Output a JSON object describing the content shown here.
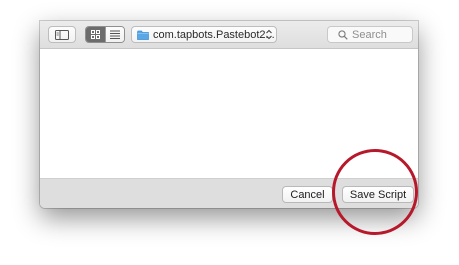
{
  "toolbar": {
    "location": "com.tapbots.Pastebot2...",
    "search_placeholder": "Search"
  },
  "footer": {
    "cancel_label": "Cancel",
    "save_label": "Save Script"
  },
  "colors": {
    "annotation": "#b6192b",
    "folder": "#5aa7e6"
  },
  "icons": {
    "sidebar_toggle": "sidebar-icon",
    "icon_view": "grid-icon",
    "list_view": "list-icon",
    "folder": "folder-icon",
    "location_chevron": "up-down-chevron-icon",
    "search": "search-icon"
  }
}
